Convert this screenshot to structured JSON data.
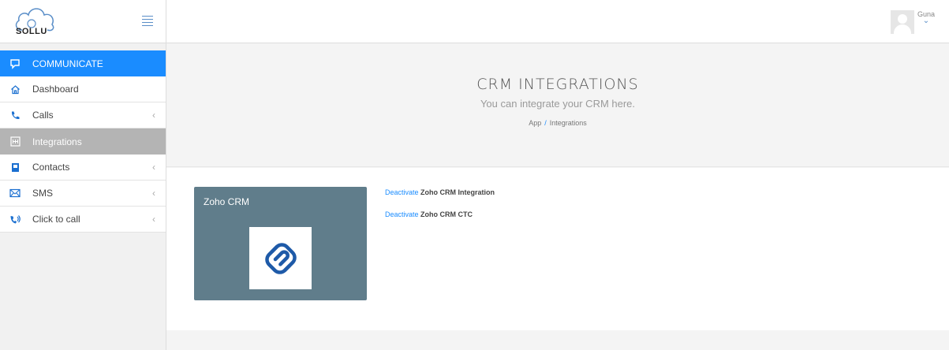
{
  "brand": {
    "name": "SOLLU"
  },
  "user": {
    "name": "Guna"
  },
  "sidebar": {
    "section": "COMMUNICATE",
    "items": [
      {
        "label": "Dashboard",
        "icon": "home-icon"
      },
      {
        "label": "Calls",
        "icon": "phone-icon"
      },
      {
        "label": "Integrations",
        "icon": "integrations-icon"
      },
      {
        "label": "Contacts",
        "icon": "contacts-icon"
      },
      {
        "label": "SMS",
        "icon": "sms-icon"
      },
      {
        "label": "Click to call",
        "icon": "click-to-call-icon"
      }
    ]
  },
  "page": {
    "title": "CRM INTEGRATIONS",
    "subtitle": "You can integrate your CRM here.",
    "breadcrumb": {
      "root": "App",
      "separator": "/",
      "current": "Integrations"
    }
  },
  "card": {
    "title": "Zoho CRM"
  },
  "actions": [
    {
      "link": "Deactivate",
      "text": "Zoho CRM Integration"
    },
    {
      "link": "Deactivate",
      "text": "Zoho CRM CTC"
    }
  ],
  "colors": {
    "accent": "#1a8cff",
    "active": "#b4b4b4",
    "card": "#607d8b"
  }
}
